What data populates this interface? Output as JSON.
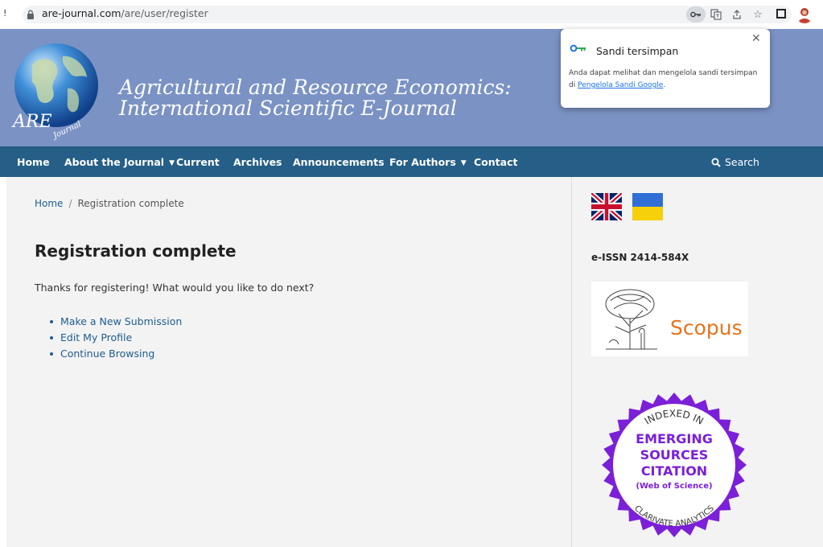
{
  "browser": {
    "url_host": "are-journal.com",
    "url_path": "/are/user/register"
  },
  "journal": {
    "logo_letters": "ARE",
    "logo_script": "Journal",
    "title_line1": "Agricultural and Resource Economics:",
    "title_line2": "International Scientific E-Journal"
  },
  "nav": {
    "items": [
      {
        "label": "Home"
      },
      {
        "label": "About the Journal",
        "has_dropdown": true
      },
      {
        "label": "Current"
      },
      {
        "label": "Archives"
      },
      {
        "label": "Announcements"
      },
      {
        "label": "For Authors",
        "has_dropdown": true
      },
      {
        "label": "Contact"
      }
    ],
    "search_label": "Search",
    "background": "#255e86"
  },
  "breadcrumb": {
    "home": "Home",
    "separator": "/",
    "current": "Registration complete"
  },
  "main": {
    "title": "Registration complete",
    "intro": "Thanks for registering! What would you like to do next?",
    "next_steps": [
      "Make a New Submission",
      "Edit My Profile",
      "Continue Browsing"
    ]
  },
  "sidebar": {
    "issn": "e-ISSN 2414-584X",
    "scopus_label": "Scopus",
    "esci": {
      "top_arc": "INDEXED IN",
      "line1": "EMERGING",
      "line2": "SOURCES",
      "line3": "CITATION",
      "line4": "(Web of Science)",
      "bottom_arc": "CLARIVATE ANALYTICS"
    }
  },
  "password_popup": {
    "title": "Sandi tersimpan",
    "body": "Anda dapat melihat dan mengelola sandi tersimpan di",
    "link": "Pengelola Sandi Google",
    "tail": "."
  },
  "colors": {
    "header": "#7b92c4",
    "nav": "#255e86",
    "link": "#1d5d8f",
    "scopus": "#e8731c",
    "esci_purple": "#7b1fd8"
  }
}
